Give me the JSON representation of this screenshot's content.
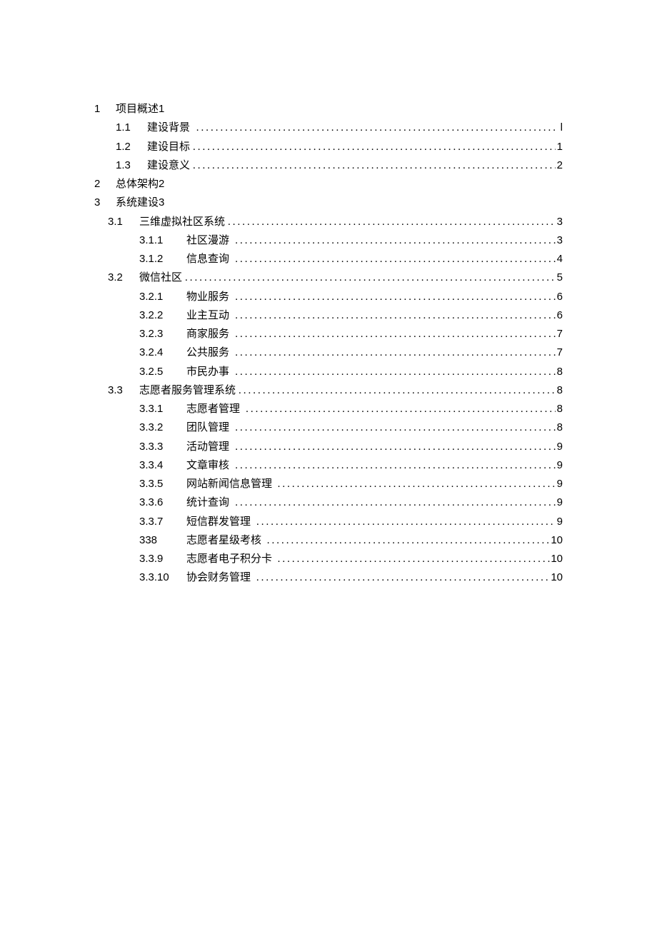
{
  "toc": [
    {
      "layout": "l1-inline",
      "num": "1",
      "title": "项目概述",
      "inline_page": "1"
    },
    {
      "layout": "l2",
      "num": "1.1",
      "title": "建设背景",
      "trailing_space": true,
      "page": "l"
    },
    {
      "layout": "l2",
      "num": "1.2",
      "title": "建设目标",
      "page": "1"
    },
    {
      "layout": "l2",
      "num": "1.3",
      "title": "建设意义",
      "page": "2"
    },
    {
      "layout": "l1-inline",
      "num": "2",
      "title": "总体架构",
      "inline_page": "2"
    },
    {
      "layout": "l1-inline",
      "num": "3",
      "title": "系统建设",
      "inline_page": "3"
    },
    {
      "layout": "l2b",
      "num": "3.1",
      "title": "三维虚拟社区系统",
      "page": "3"
    },
    {
      "layout": "l3",
      "num": "3.1.1",
      "title": "社区漫游",
      "trailing_space": true,
      "page": "3"
    },
    {
      "layout": "l3",
      "num": "3.1.2",
      "title": "信息查询",
      "trailing_space": true,
      "page": "4"
    },
    {
      "layout": "l2b",
      "num": "3.2",
      "title": "微信社区",
      "page": "5"
    },
    {
      "layout": "l3",
      "num": "3.2.1",
      "title": "物业服务",
      "trailing_space": true,
      "page": "6"
    },
    {
      "layout": "l3",
      "num": "3.2.2",
      "title": "业主互动",
      "trailing_space": true,
      "page": "6"
    },
    {
      "layout": "l3",
      "num": "3.2.3",
      "title": "商家服务",
      "trailing_space": true,
      "page": "7"
    },
    {
      "layout": "l3",
      "num": "3.2.4",
      "title": "公共服务",
      "trailing_space": true,
      "page": "7"
    },
    {
      "layout": "l3",
      "num": "3.2.5",
      "title": "市民办事",
      "trailing_space": true,
      "page": "8"
    },
    {
      "layout": "l2b",
      "num": "3.3",
      "title": "志愿者服务管理系统",
      "page": "8"
    },
    {
      "layout": "l3",
      "num": "3.3.1",
      "title": "志愿者管理",
      "trailing_space": true,
      "page": "8"
    },
    {
      "layout": "l3",
      "num": "3.3.2",
      "title": "团队管理",
      "trailing_space": true,
      "page": "8"
    },
    {
      "layout": "l3",
      "num": "3.3.3",
      "title": "活动管理",
      "trailing_space": true,
      "page": "9"
    },
    {
      "layout": "l3",
      "num": "3.3.4",
      "title": "文章审核",
      "trailing_space": true,
      "page": "9"
    },
    {
      "layout": "l3",
      "num": "3.3.5",
      "title": "网站新闻信息管理",
      "trailing_space": true,
      "page": "9"
    },
    {
      "layout": "l3",
      "num": "3.3.6",
      "title": "统计查询",
      "trailing_space": true,
      "page": "9"
    },
    {
      "layout": "l3",
      "num": "3.3.7",
      "title": "短信群发管理",
      "trailing_space": true,
      "page": "9"
    },
    {
      "layout": "l3",
      "num": "338",
      "title": "志愿者星级考核",
      "trailing_space": true,
      "page": "10"
    },
    {
      "layout": "l3",
      "num": "3.3.9",
      "title": "志愿者电子积分卡",
      "trailing_space": true,
      "page": "10"
    },
    {
      "layout": "l3",
      "num": "3.3.10",
      "title": "协会财务管理",
      "trailing_space": true,
      "page": "10"
    }
  ]
}
